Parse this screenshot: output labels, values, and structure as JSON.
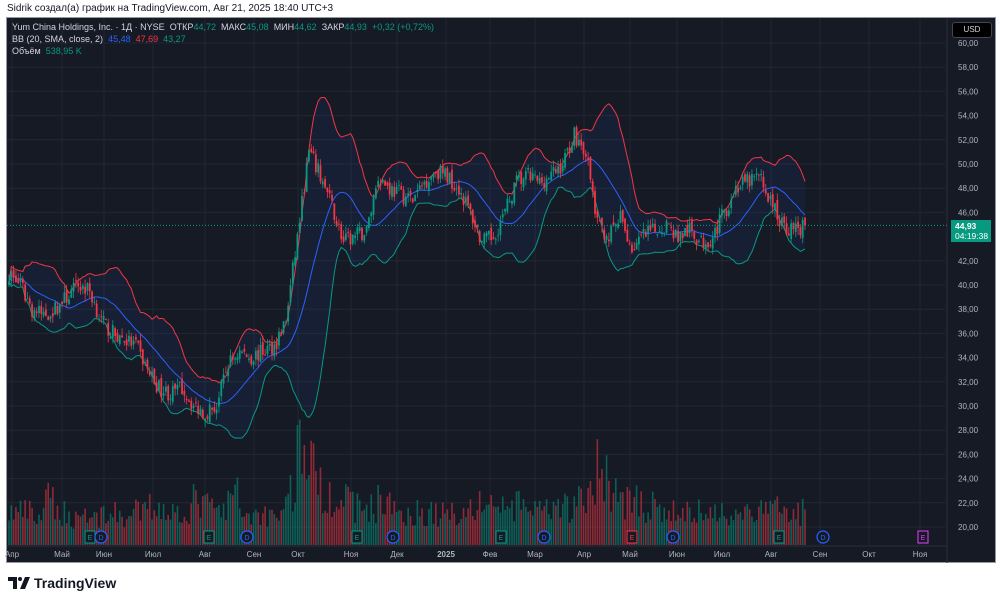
{
  "attribution": "Sidrik создал(а) график на TradingView.com, Авг 21, 2025 18:40 UTC+3",
  "legend": {
    "symbol": "Yum China Holdings, Inc. · 1Д · NYSE",
    "open_label": "ОТКР",
    "open": "44,72",
    "high_label": "МАКС",
    "high": "45,08",
    "low_label": "МИН",
    "low": "44,62",
    "close_label": "ЗАКР",
    "close": "44,93",
    "change": "+0,32 (+0,72%)",
    "bb_label": "BB (20, SMA, close, 2)",
    "bb_basis": "45,48",
    "bb_upper": "47,69",
    "bb_lower": "43,27",
    "volume_label": "Объём",
    "volume": "538,95 K"
  },
  "currency": "USD",
  "last_price": {
    "value": "44,93",
    "countdown": "04:19:38"
  },
  "colors": {
    "up": "#089981",
    "down": "#f23645",
    "basis": "#2962ff",
    "upper": "#f23645",
    "lower": "#089981",
    "background": "#161a25"
  },
  "logo_text": "TradingView",
  "chart_data": {
    "type": "candlestick",
    "interval": "1D",
    "ylim": [
      19,
      61
    ],
    "y_ticks": [
      "60,00",
      "58,00",
      "56,00",
      "54,00",
      "52,00",
      "50,00",
      "48,00",
      "46,00",
      "42,00",
      "40,00",
      "38,00",
      "36,00",
      "34,00",
      "32,00",
      "30,00",
      "28,00",
      "26,00",
      "24,00",
      "22,00",
      "20,00"
    ],
    "x_ticks": [
      "Апр",
      "Май",
      "Июн",
      "Июл",
      "Авг",
      "Сен",
      "Окт",
      "Ноя",
      "Дек",
      "2025",
      "Фев",
      "Мар",
      "Апр",
      "Май",
      "Июн",
      "Июл",
      "Авг",
      "Сен",
      "Окт",
      "Ноя"
    ],
    "weekly_close": [
      41,
      40,
      38,
      37.5,
      38,
      39,
      40,
      39.5,
      37,
      36,
      35.5,
      35,
      33,
      31.5,
      31,
      31.5,
      30,
      29.5,
      30,
      33.5,
      34.5,
      34,
      34.5,
      35,
      37,
      44,
      51,
      49,
      46.5,
      43.5,
      44,
      44.5,
      49,
      48,
      47.5,
      47,
      48.5,
      49.5,
      49,
      48,
      46,
      43.5,
      44,
      46,
      48.5,
      49,
      48.5,
      49,
      50,
      52.5,
      51,
      45,
      44,
      45.5,
      43,
      44,
      44.5,
      45,
      44,
      44.5,
      43.5,
      44,
      46,
      48,
      48.5,
      49,
      47,
      45,
      44.5,
      44.93
    ],
    "weekly_volume_rel": [
      3,
      3,
      2.5,
      4,
      3,
      2.5,
      3,
      2.5,
      3,
      2.8,
      2.5,
      3,
      3.5,
      3.5,
      3,
      3.2,
      4,
      3.5,
      3,
      4.5,
      3,
      2.8,
      2.8,
      3,
      5,
      9,
      7,
      5,
      4.5,
      4,
      3.5,
      3.5,
      4,
      3.5,
      3,
      3,
      3,
      2.8,
      3,
      3,
      3.5,
      4,
      3.5,
      3.5,
      3.5,
      3.5,
      3,
      3,
      3.5,
      4,
      4.5,
      7,
      5,
      4,
      4,
      3.5,
      3,
      3,
      3,
      3,
      3,
      3,
      3,
      3,
      3,
      3,
      3.5,
      3.5,
      3,
      2.5
    ],
    "events": [
      {
        "type": "E",
        "date": "Май 2024"
      },
      {
        "type": "D",
        "date": "Июн 2024"
      },
      {
        "type": "E",
        "date": "Авг 2024"
      },
      {
        "type": "D",
        "date": "Сен 2024"
      },
      {
        "type": "E",
        "date": "Ноя 2024"
      },
      {
        "type": "D",
        "date": "Дек 2024"
      },
      {
        "type": "E",
        "date": "Фев 2025"
      },
      {
        "type": "D",
        "date": "Мар 2025"
      },
      {
        "type": "E",
        "date": "Май 2025",
        "color": "#f23645"
      },
      {
        "type": "D",
        "date": "Июн 2025"
      },
      {
        "type": "E",
        "date": "Авг 2025"
      },
      {
        "type": "D",
        "date": "Сен 2025"
      },
      {
        "type": "E",
        "date": "Ноя 2025",
        "color": "#e040fb"
      }
    ],
    "bollinger": {
      "period": 20,
      "stddev": 2
    }
  }
}
